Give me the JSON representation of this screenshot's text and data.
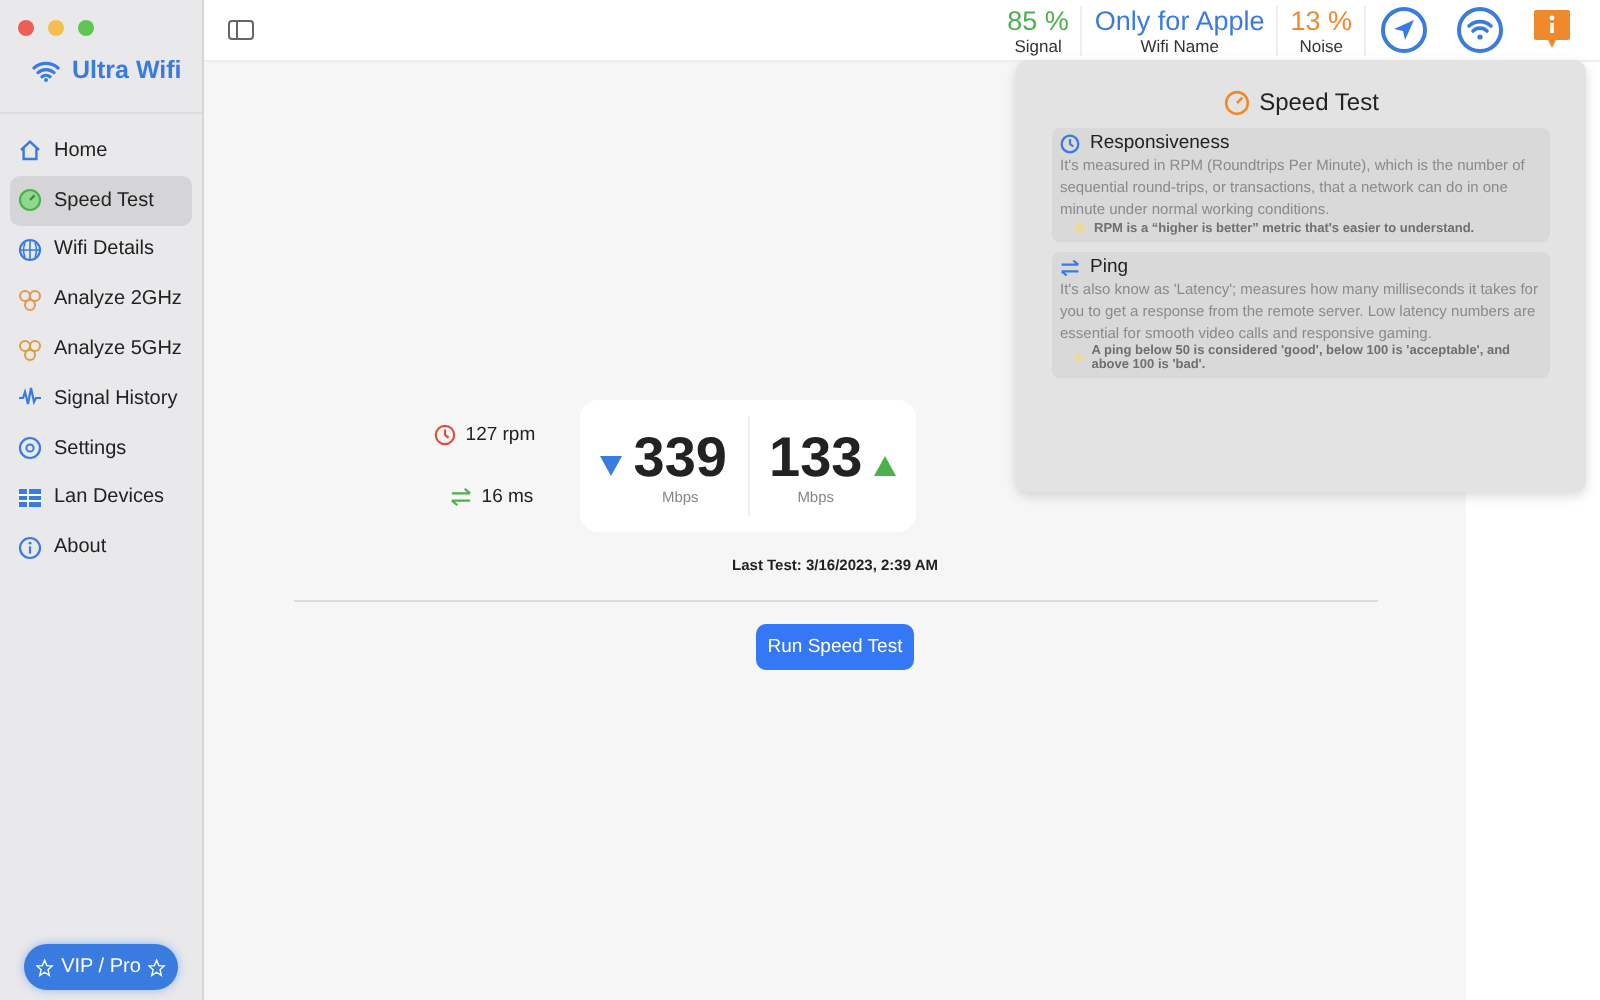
{
  "app": {
    "name": "Ultra Wifi"
  },
  "sidebar": {
    "items": [
      {
        "label": "Home",
        "selected": false
      },
      {
        "label": "Speed Test",
        "selected": true
      },
      {
        "label": "Wifi Details",
        "selected": false
      },
      {
        "label": "Analyze 2GHz",
        "selected": false
      },
      {
        "label": "Analyze 5GHz",
        "selected": false
      },
      {
        "label": "Signal History",
        "selected": false
      },
      {
        "label": "Settings",
        "selected": false
      },
      {
        "label": "Lan Devices",
        "selected": false
      },
      {
        "label": "About",
        "selected": false
      }
    ],
    "vip_button": "VIP / Pro"
  },
  "toolbar": {
    "stats": [
      {
        "value": "85 %",
        "label": "Signal",
        "color": "#4cb04c"
      },
      {
        "value": "Only for Apple",
        "label": "Wifi Name",
        "color": "#3a7be0"
      },
      {
        "value": "13 %",
        "label": "Noise",
        "color": "#ef8a2c"
      }
    ]
  },
  "speed_test": {
    "responsiveness": "127 rpm",
    "ping": "16 ms",
    "download": "339",
    "download_unit": "Mbps",
    "upload": "133",
    "upload_unit": "Mbps",
    "last_test": "Last Test: 3/16/2023, 2:39 AM",
    "run_button": "Run Speed Test"
  },
  "popover": {
    "title": "Speed Test",
    "sections": [
      {
        "title": "Responsiveness",
        "body": "It's measured in RPM (Roundtrips Per Minute), which is the number of sequential round-trips, or transactions, that a network can do in one minute under normal working conditions.",
        "tip": "RPM is a “higher is better” metric that's easier to understand."
      },
      {
        "title": "Ping",
        "body": "It's also know as 'Latency'; measures how many milliseconds it takes for you to get a response from the remote server. Low latency numbers are essential for smooth video calls and responsive gaming.",
        "tip": "A ping below 50 is considered 'good', below 100 is 'acceptable', and above 100 is 'bad'."
      }
    ]
  }
}
